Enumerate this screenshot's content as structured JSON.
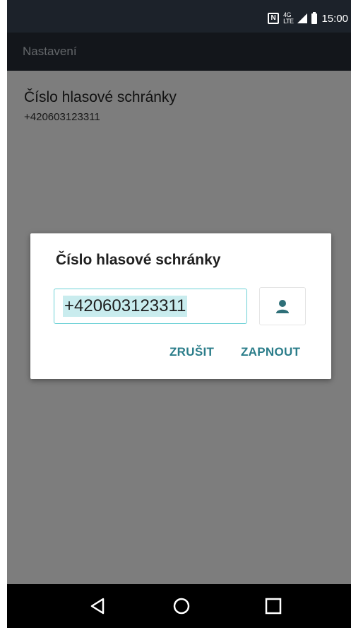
{
  "status_bar": {
    "lte_label": "4G\nLTE",
    "time": "15:00",
    "icons": [
      "nfc-icon",
      "lte-icon",
      "signal-icon",
      "battery-icon"
    ]
  },
  "app_bar": {
    "title": "Nastavení"
  },
  "preference": {
    "title": "Číslo hlasové schránky",
    "summary": "+420603123311"
  },
  "dialog": {
    "title": "Číslo hlasové schránky",
    "input_value": "+420603123311",
    "contact_icon": "person-icon",
    "cancel_label": "ZRUŠIT",
    "enable_label": "ZAPNOUT"
  },
  "nav_bar": {
    "icons": [
      "back-icon",
      "home-icon",
      "recents-icon"
    ]
  },
  "colors": {
    "status_bar": "#1c222a",
    "app_bar": "#262d37",
    "accent": "#2b7d8a",
    "input_border": "#6cd1d6",
    "selection": "#c9ecee"
  }
}
